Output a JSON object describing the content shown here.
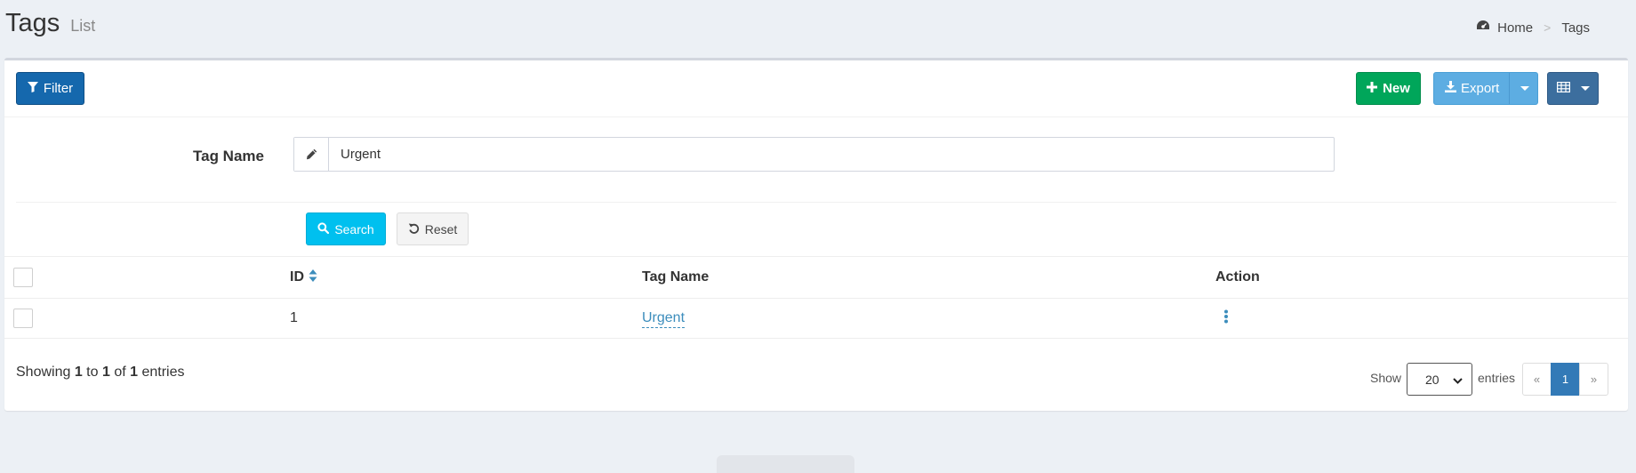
{
  "header": {
    "title": "Tags",
    "subtitle": "List"
  },
  "breadcrumb": {
    "home": "Home",
    "separator": ">",
    "current": "Tags"
  },
  "toolbar": {
    "filter_label": "Filter",
    "new_label": "New",
    "export_label": "Export"
  },
  "filter": {
    "tag_name_label": "Tag Name",
    "tag_name_value": "Urgent",
    "search_label": "Search",
    "reset_label": "Reset"
  },
  "table": {
    "columns": {
      "id": "ID",
      "tag_name": "Tag Name",
      "action": "Action"
    },
    "rows": [
      {
        "id": "1",
        "tag_name": "Urgent"
      }
    ]
  },
  "footer": {
    "showing_prefix": "Showing ",
    "from": "1",
    "to_word": " to ",
    "to": "1",
    "of_word": " of ",
    "total": "1",
    "entries_word": " entries",
    "show_label": "Show",
    "per_page": "20",
    "entries_label": "entries",
    "prev": "«",
    "current_page": "1",
    "next": "»"
  },
  "colors": {
    "filter_btn": "#1568ad",
    "new_btn": "#00a65a",
    "export_btn": "#5dade2",
    "columns_btn": "#3c6e9e",
    "search_btn": "#00c0ef",
    "link": "#3c8dbc",
    "page_active": "#337ab7"
  },
  "icons": {
    "breadcrumb": "dashboard-icon",
    "filter": "filter-icon",
    "new": "plus-icon",
    "export": "download-icon",
    "columns": "table-icon",
    "input_addon": "pencil-icon",
    "search": "search-icon",
    "reset": "undo-icon",
    "sort": "sort-icon",
    "action": "ellipsis-vertical-icon"
  }
}
